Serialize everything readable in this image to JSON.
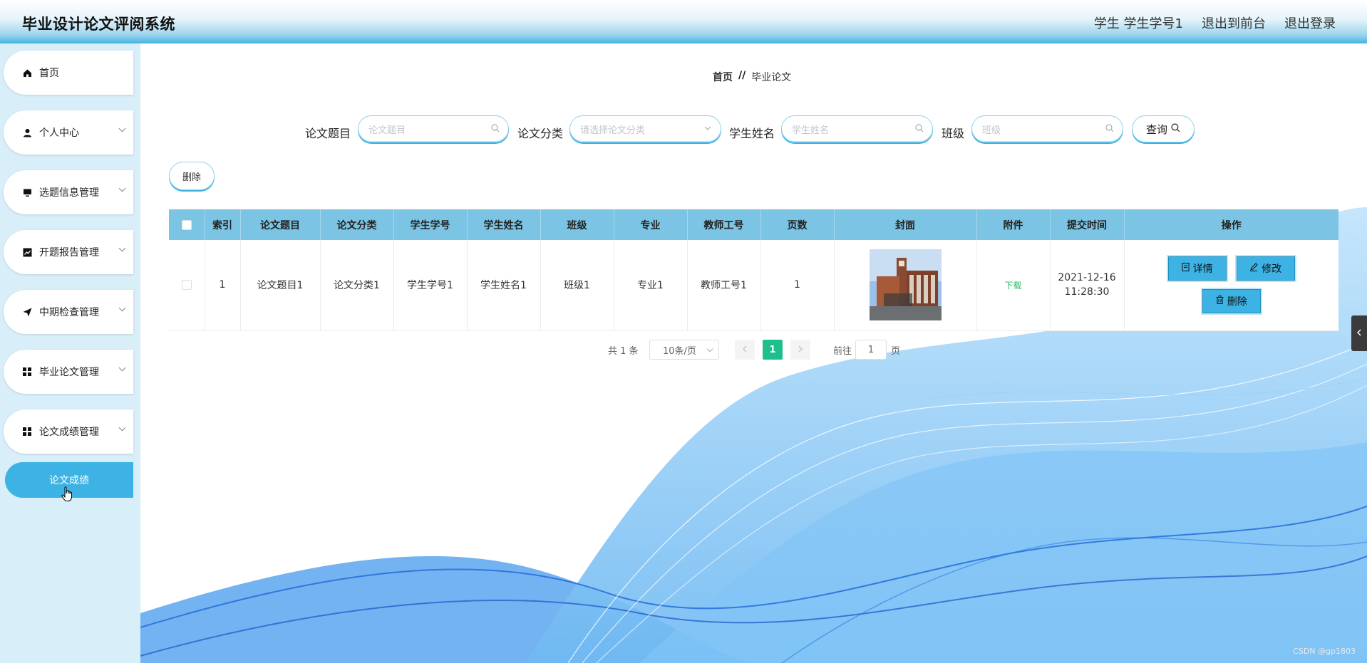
{
  "header": {
    "app_title": "毕业设计论文评阅系统",
    "user_label": "学生 学生学号1",
    "back_to_front": "退出到前台",
    "logout": "退出登录"
  },
  "sidebar": {
    "items": [
      {
        "label": "首页",
        "icon": "home-icon"
      },
      {
        "label": "个人中心",
        "icon": "user-icon"
      },
      {
        "label": "选题信息管理",
        "icon": "monitor-icon"
      },
      {
        "label": "开题报告管理",
        "icon": "chart-icon"
      },
      {
        "label": "中期检查管理",
        "icon": "send-icon"
      },
      {
        "label": "毕业论文管理",
        "icon": "grid-icon"
      },
      {
        "label": "论文成绩管理",
        "icon": "grid-icon"
      }
    ],
    "active_sub": "论文成绩"
  },
  "breadcrumb": {
    "home": "首页",
    "sep": "//",
    "current": "毕业论文"
  },
  "filters": {
    "title_label": "论文题目",
    "title_placeholder": "论文题目",
    "category_label": "论文分类",
    "category_placeholder": "请选择论文分类",
    "student_label": "学生姓名",
    "student_placeholder": "学生姓名",
    "class_label": "班级",
    "class_placeholder": "班级",
    "query_label": "查询"
  },
  "delete_label": "删除",
  "table": {
    "columns": [
      "索引",
      "论文题目",
      "论文分类",
      "学生学号",
      "学生姓名",
      "班级",
      "专业",
      "教师工号",
      "页数",
      "封面",
      "附件",
      "提交时间",
      "操作"
    ],
    "rows": [
      {
        "index": "1",
        "title": "论文题目1",
        "category": "论文分类1",
        "student_no": "学生学号1",
        "student_name": "学生姓名1",
        "class": "班级1",
        "major": "专业1",
        "teacher_no": "教师工号1",
        "pages": "1",
        "attachment": "下载",
        "submit_date": "2021-12-16",
        "submit_time": "11:28:30",
        "actions": {
          "detail": "详情",
          "edit": "修改",
          "delete": "删除"
        }
      }
    ]
  },
  "pagination": {
    "total_text": "共 1 条",
    "page_size": "10条/页",
    "current_page": "1",
    "goto_prefix": "前往",
    "goto_value": "1",
    "goto_suffix": "页"
  },
  "watermark": "CSDN @gp1803",
  "colors": {
    "accent": "#3cb3e4",
    "header_blue": "#4db8e3",
    "table_header": "#7cc4e4",
    "page_active": "#1ebf8c"
  }
}
